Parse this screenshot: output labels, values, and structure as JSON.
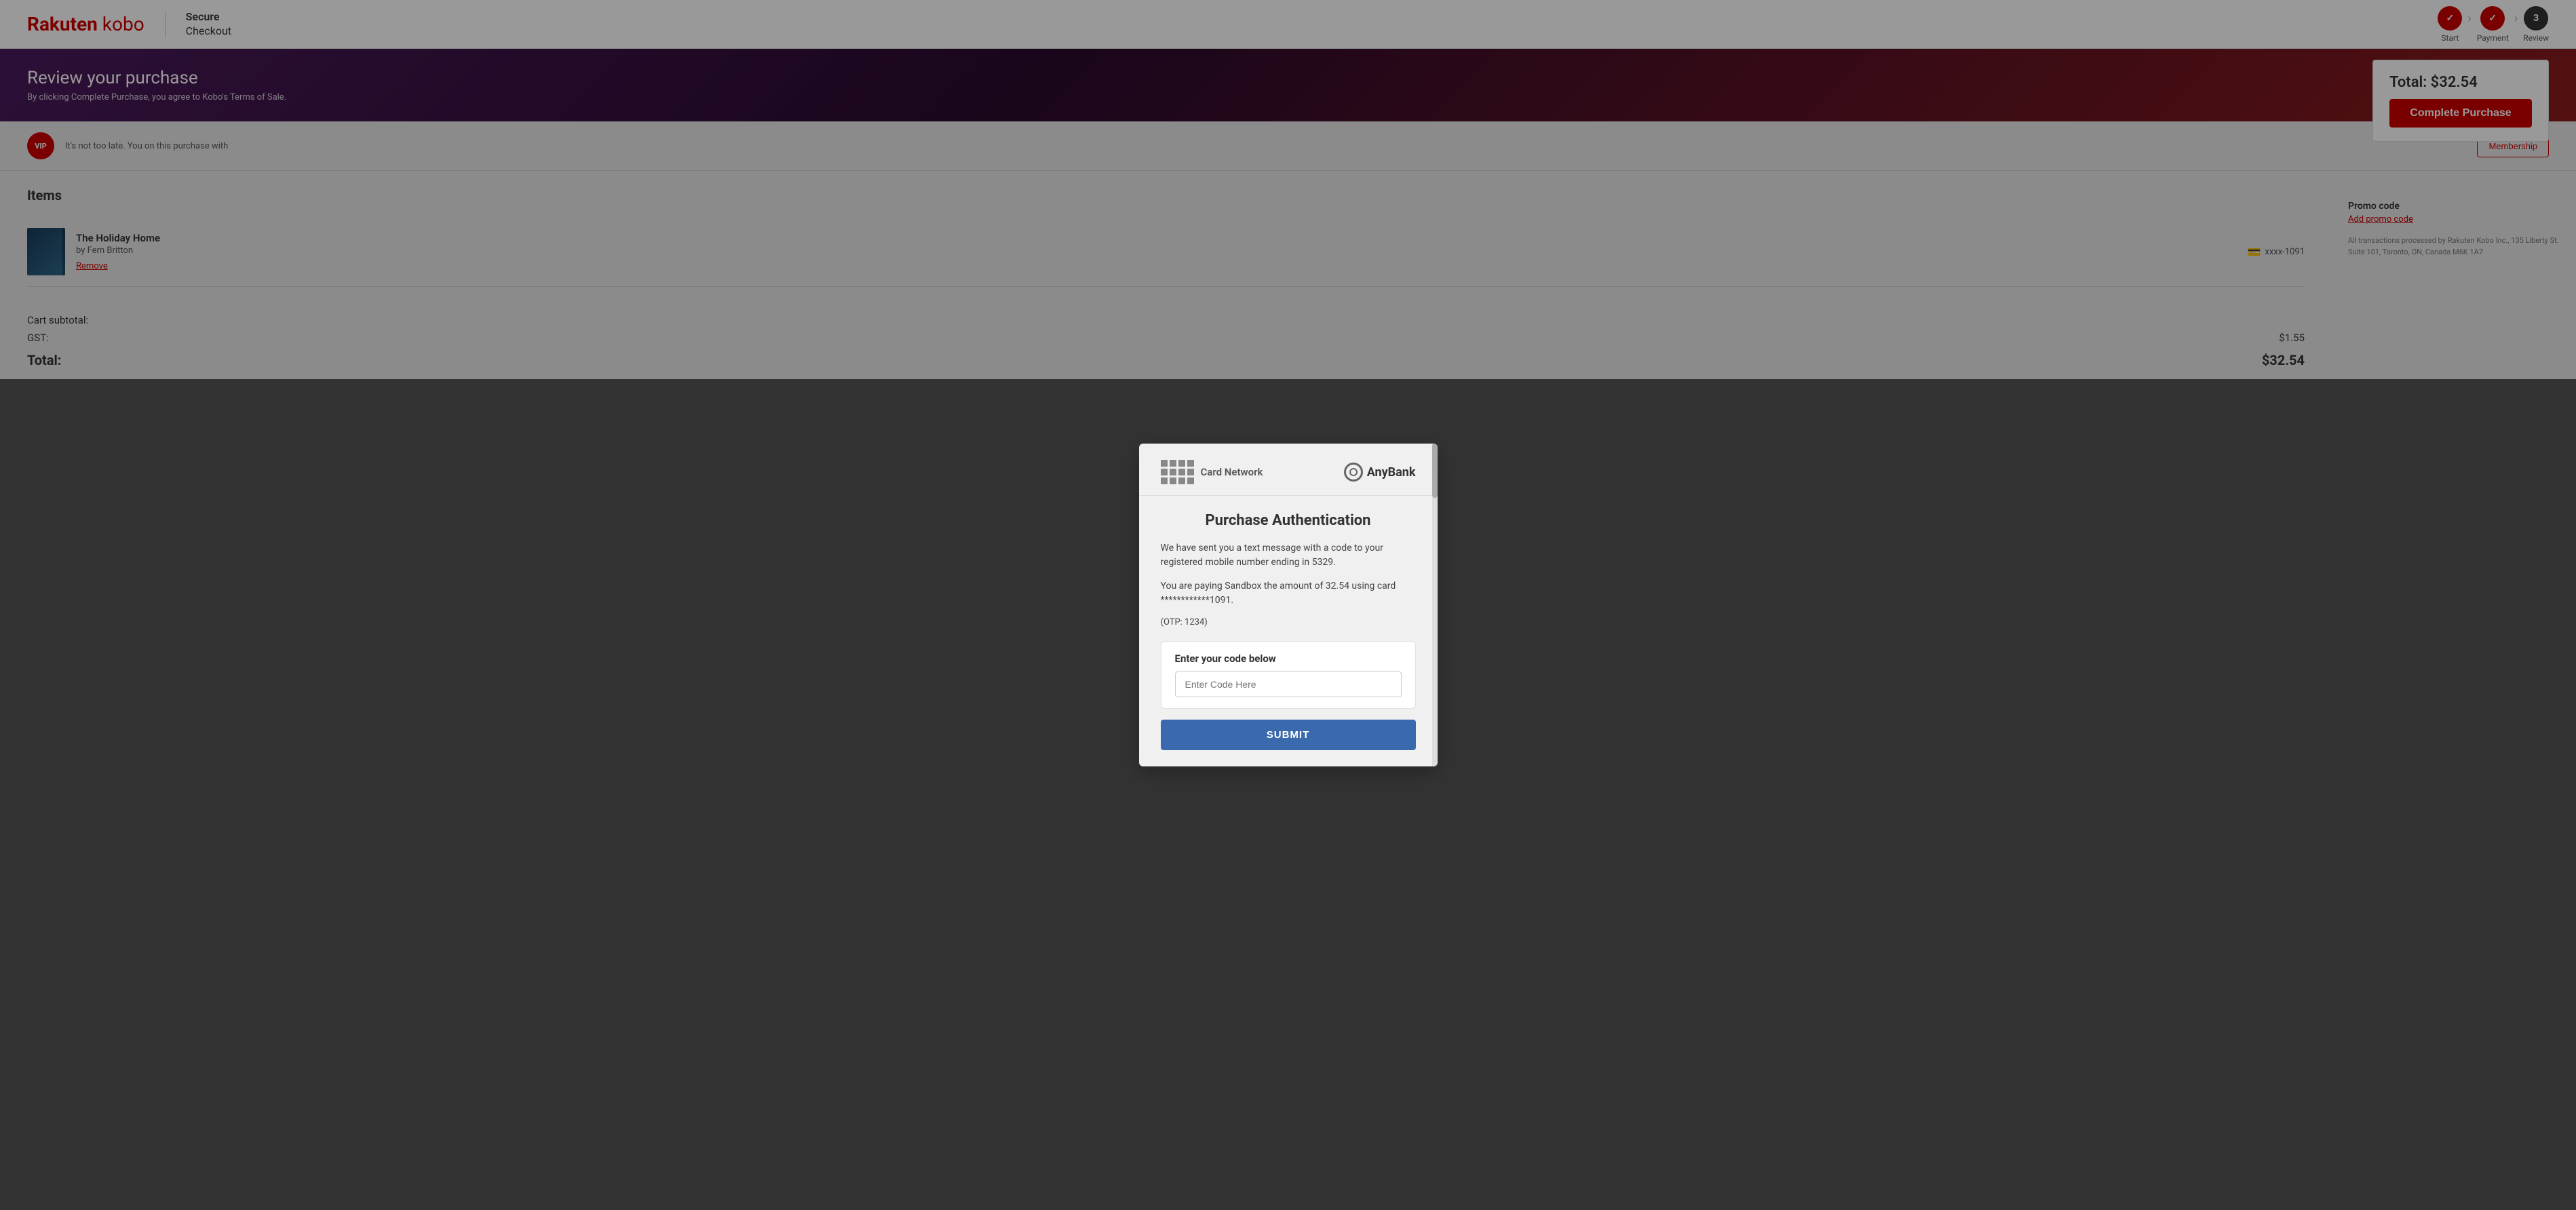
{
  "header": {
    "logo_rakuten": "Rakuten",
    "logo_kobo": " kobo",
    "checkout_label": "Secure\nCheckout",
    "steps": [
      {
        "label": "Start",
        "state": "done",
        "icon": "✓"
      },
      {
        "label": "Payment",
        "state": "done",
        "icon": "✓"
      },
      {
        "label": "Review",
        "state": "active",
        "number": "3"
      }
    ]
  },
  "banner": {
    "title": "Review your purchase",
    "subtitle": "By clicking Complete Purchase, you agree to Kobo's Terms of Sale."
  },
  "total_card": {
    "label": "Total: $32.54",
    "button_label": "Complete Purchase"
  },
  "vip": {
    "badge": "VIP",
    "text": "It's not too late. You",
    "text2": "on this purchase with",
    "membership_btn": "Membership"
  },
  "items": {
    "section_title": "Items",
    "list": [
      {
        "title": "The Holiday Home",
        "author": "by Fern Britton",
        "remove_label": "Remove",
        "card_label": "xxxx-1091"
      }
    ]
  },
  "cart": {
    "subtotal_label": "Cart subtotal:",
    "gst_label": "GST:",
    "gst_value": "$1.55",
    "total_label": "Total:",
    "total_value": "$32.54"
  },
  "sidebar": {
    "promo_label": "Promo code",
    "promo_link": "Add promo code",
    "footer": "All transactions processed by Rakuten Kobo Inc., 135 Liberty St. Suite 101, Toronto, ON, Canada M6K 1A7"
  },
  "modal": {
    "card_network_label": "Card Network",
    "anybank_label": "AnyBank",
    "title": "Purchase Authentication",
    "description1": "We have sent you a text message with a code to your registered mobile number ending in 5329.",
    "description2": "You are paying Sandbox the amount of 32.54 using card ************1091.",
    "otp_hint": "(OTP: 1234)",
    "code_section_label": "Enter your code below",
    "input_placeholder": "Enter Code Here",
    "submit_label": "SUBMIT"
  }
}
